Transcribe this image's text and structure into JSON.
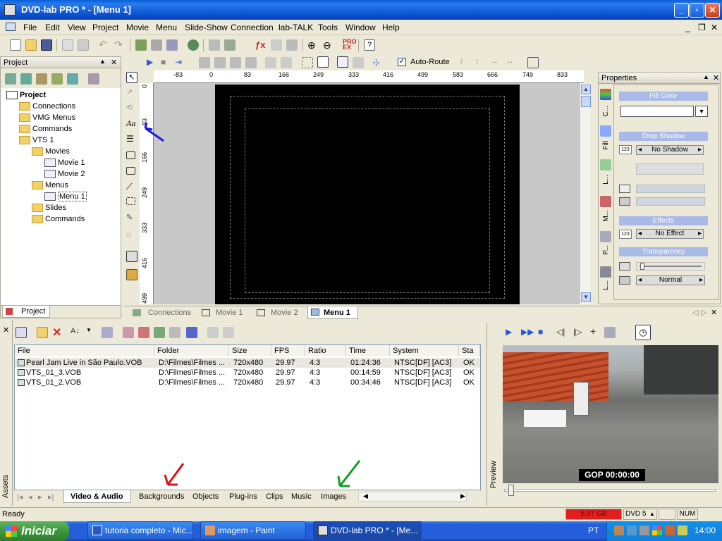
{
  "window": {
    "title": "DVD-lab PRO * - [Menu 1]"
  },
  "menubar": [
    "File",
    "Edit",
    "View",
    "Project",
    "Movie",
    "Menu",
    "Slide-Show",
    "Connection",
    "lab-TALK",
    "Tools",
    "Window",
    "Help"
  ],
  "toolbar": {
    "auto_route_label": "Auto-Route"
  },
  "ruler": {
    "top_ticks": [
      "-83",
      "0",
      "83",
      "166",
      "249",
      "333",
      "416",
      "499",
      "583",
      "666",
      "749",
      "833"
    ],
    "left_ticks": [
      "0",
      "83",
      "166",
      "249",
      "333",
      "416",
      "499"
    ]
  },
  "project_panel": {
    "title": "Project",
    "tab_label": "Project",
    "tree": [
      {
        "label": "Project",
        "level": 0,
        "bold": true
      },
      {
        "label": "Connections",
        "level": 1
      },
      {
        "label": "VMG Menus",
        "level": 1
      },
      {
        "label": "Commands",
        "level": 1
      },
      {
        "label": "VTS 1",
        "level": 1
      },
      {
        "label": "Movies",
        "level": 2
      },
      {
        "label": "Movie 1",
        "level": 3
      },
      {
        "label": "Movie 2",
        "level": 3
      },
      {
        "label": "Menus",
        "level": 2
      },
      {
        "label": "Menu 1",
        "level": 3,
        "selected": true
      },
      {
        "label": "Slides",
        "level": 2
      },
      {
        "label": "Commands",
        "level": 2
      }
    ]
  },
  "properties": {
    "title": "Properties",
    "fill_color": "Fill Color",
    "drop_shadow": "Drop Shadow",
    "shadow_value": "No Shadow",
    "effects": "Effects",
    "effect_value": "No Effect",
    "transparency": "Transparency",
    "blend_value": "Normal",
    "side_tabs": [
      "C...",
      "Fill",
      "L...",
      "M...",
      "P...",
      "L..."
    ],
    "num_badge": "123"
  },
  "doc_tabs": [
    "Connections",
    "Movie 1",
    "Movie 2",
    "Menu 1"
  ],
  "assets": {
    "side_label": "Assets",
    "columns": [
      "File",
      "Folder",
      "Size",
      "FPS",
      "Ratio",
      "Time",
      "System",
      "Sta"
    ],
    "rows": [
      {
        "file": "Pearl Jam Live in São Paulo.VOB",
        "folder": "D:\\Filmes\\Filmes ...",
        "size": "720x480",
        "fps": "29.97",
        "ratio": "4:3",
        "time": "01:24:36",
        "system": "NTSC[DF] [AC3]",
        "status": "OK"
      },
      {
        "file": "VTS_01_3.VOB",
        "folder": "D:\\Filmes\\Filmes ...",
        "size": "720x480",
        "fps": "29.97",
        "ratio": "4:3",
        "time": "00:14:59",
        "system": "NTSC[DF] [AC3]",
        "status": "OK"
      },
      {
        "file": "VTS_01_2.VOB",
        "folder": "D:\\Filmes\\Filmes ...",
        "size": "720x480",
        "fps": "29.97",
        "ratio": "4:3",
        "time": "00:34:46",
        "system": "NTSC[DF] [AC3]",
        "status": "OK"
      }
    ],
    "tabs": [
      "Video & Audio",
      "Backgrounds",
      "Objects",
      "Plug-ins",
      "Clips",
      "Music",
      "Images"
    ]
  },
  "preview": {
    "side_label": "Preview",
    "gop": "GOP 00:00:00"
  },
  "status": {
    "text": "Ready",
    "size": "5.97 GB",
    "disc": "DVD 5",
    "num": "NUM"
  },
  "taskbar": {
    "start": "Iniciar",
    "items": [
      "tutoria completo - Mic...",
      "imagem - Paint",
      "DVD-lab PRO * - [Me..."
    ],
    "lang": "PT",
    "clock": "14:00"
  },
  "colors": {
    "accent": "#0a5fd8",
    "canvas": "#000000",
    "size_bar": "#e02020"
  }
}
